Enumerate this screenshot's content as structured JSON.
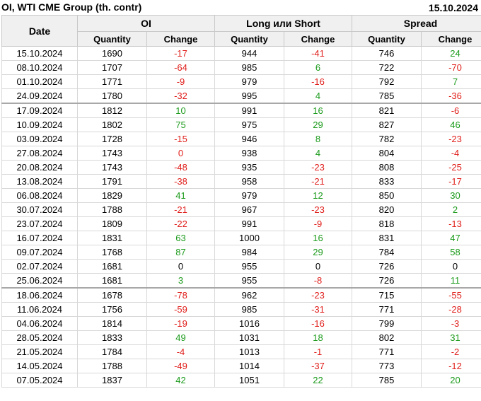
{
  "title": "OI, WTI CME Group (th. contr)",
  "date": "15.10.2024",
  "headers": {
    "date": "Date",
    "groups": [
      "OI",
      "Long или Short",
      "Spread"
    ],
    "quantity": "Quantity",
    "change": "Change"
  },
  "colors": {
    "positive": "#1c9b1c",
    "negative": "#e0201c"
  },
  "rows": [
    {
      "date": "15.10.2024",
      "oi_q": "1690",
      "oi_c": "-17",
      "ls_q": "944",
      "ls_c": "-41",
      "sp_q": "746",
      "sp_c": "24"
    },
    {
      "date": "08.10.2024",
      "oi_q": "1707",
      "oi_c": "-64",
      "ls_q": "985",
      "ls_c": "6",
      "sp_q": "722",
      "sp_c": "-70"
    },
    {
      "date": "01.10.2024",
      "oi_q": "1771",
      "oi_c": "-9",
      "ls_q": "979",
      "ls_c": "-16",
      "sp_q": "792",
      "sp_c": "7"
    },
    {
      "date": "24.09.2024",
      "oi_q": "1780",
      "oi_c": "-32",
      "ls_q": "995",
      "ls_c": "4",
      "sp_q": "785",
      "sp_c": "-36"
    },
    {
      "date": "17.09.2024",
      "oi_q": "1812",
      "oi_c": "10",
      "ls_q": "991",
      "ls_c": "16",
      "sp_q": "821",
      "sp_c": "-6",
      "sep": true
    },
    {
      "date": "10.09.2024",
      "oi_q": "1802",
      "oi_c": "75",
      "ls_q": "975",
      "ls_c": "29",
      "sp_q": "827",
      "sp_c": "46"
    },
    {
      "date": "03.09.2024",
      "oi_q": "1728",
      "oi_c": "-15",
      "ls_q": "946",
      "ls_c": "8",
      "sp_q": "782",
      "sp_c": "-23"
    },
    {
      "date": "27.08.2024",
      "oi_q": "1743",
      "oi_c": "0",
      "ls_q": "938",
      "ls_c": "4",
      "sp_q": "804",
      "sp_c": "-4",
      "oi_c_tone": "neg"
    },
    {
      "date": "20.08.2024",
      "oi_q": "1743",
      "oi_c": "-48",
      "ls_q": "935",
      "ls_c": "-23",
      "sp_q": "808",
      "sp_c": "-25"
    },
    {
      "date": "13.08.2024",
      "oi_q": "1791",
      "oi_c": "-38",
      "ls_q": "958",
      "ls_c": "-21",
      "sp_q": "833",
      "sp_c": "-17"
    },
    {
      "date": "06.08.2024",
      "oi_q": "1829",
      "oi_c": "41",
      "ls_q": "979",
      "ls_c": "12",
      "sp_q": "850",
      "sp_c": "30"
    },
    {
      "date": "30.07.2024",
      "oi_q": "1788",
      "oi_c": "-21",
      "ls_q": "967",
      "ls_c": "-23",
      "sp_q": "820",
      "sp_c": "2"
    },
    {
      "date": "23.07.2024",
      "oi_q": "1809",
      "oi_c": "-22",
      "ls_q": "991",
      "ls_c": "-9",
      "sp_q": "818",
      "sp_c": "-13"
    },
    {
      "date": "16.07.2024",
      "oi_q": "1831",
      "oi_c": "63",
      "ls_q": "1000",
      "ls_c": "16",
      "sp_q": "831",
      "sp_c": "47"
    },
    {
      "date": "09.07.2024",
      "oi_q": "1768",
      "oi_c": "87",
      "ls_q": "984",
      "ls_c": "29",
      "sp_q": "784",
      "sp_c": "58"
    },
    {
      "date": "02.07.2024",
      "oi_q": "1681",
      "oi_c": "0",
      "ls_q": "955",
      "ls_c": "0",
      "sp_q": "726",
      "sp_c": "0"
    },
    {
      "date": "25.06.2024",
      "oi_q": "1681",
      "oi_c": "3",
      "ls_q": "955",
      "ls_c": "-8",
      "sp_q": "726",
      "sp_c": "11"
    },
    {
      "date": "18.06.2024",
      "oi_q": "1678",
      "oi_c": "-78",
      "ls_q": "962",
      "ls_c": "-23",
      "sp_q": "715",
      "sp_c": "-55",
      "sep": true
    },
    {
      "date": "11.06.2024",
      "oi_q": "1756",
      "oi_c": "-59",
      "ls_q": "985",
      "ls_c": "-31",
      "sp_q": "771",
      "sp_c": "-28"
    },
    {
      "date": "04.06.2024",
      "oi_q": "1814",
      "oi_c": "-19",
      "ls_q": "1016",
      "ls_c": "-16",
      "sp_q": "799",
      "sp_c": "-3"
    },
    {
      "date": "28.05.2024",
      "oi_q": "1833",
      "oi_c": "49",
      "ls_q": "1031",
      "ls_c": "18",
      "sp_q": "802",
      "sp_c": "31"
    },
    {
      "date": "21.05.2024",
      "oi_q": "1784",
      "oi_c": "-4",
      "ls_q": "1013",
      "ls_c": "-1",
      "sp_q": "771",
      "sp_c": "-2"
    },
    {
      "date": "14.05.2024",
      "oi_q": "1788",
      "oi_c": "-49",
      "ls_q": "1014",
      "ls_c": "-37",
      "sp_q": "773",
      "sp_c": "-12"
    },
    {
      "date": "07.05.2024",
      "oi_q": "1837",
      "oi_c": "42",
      "ls_q": "1051",
      "ls_c": "22",
      "sp_q": "785",
      "sp_c": "20"
    }
  ]
}
